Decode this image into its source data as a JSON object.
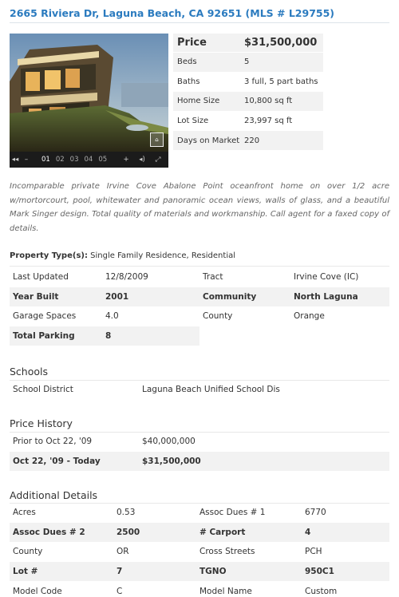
{
  "listing": {
    "title": "2665 Riviera Dr, Laguna Beach, CA 92651 (MLS # L29755)"
  },
  "gallery": {
    "pages": [
      "01",
      "02",
      "03",
      "04",
      "05"
    ],
    "active_page": "01",
    "controls": {
      "prev": "◂◂",
      "minus": "–",
      "plus": "+",
      "sound": "◂)",
      "fullscreen": "⤢"
    },
    "badge_icon": "house-icon"
  },
  "summary": [
    {
      "label": "Price",
      "value": "$31,500,000"
    },
    {
      "label": "Beds",
      "value": "5"
    },
    {
      "label": "Baths",
      "value": "3 full, 5 part baths"
    },
    {
      "label": "Home Size",
      "value": "10,800 sq ft"
    },
    {
      "label": "Lot Size",
      "value": "23,997 sq ft"
    },
    {
      "label": "Days on Market",
      "value": "220"
    }
  ],
  "description": "Incomparable private Irvine Cove Abalone Point oceanfront home on over 1/2 acre w/mortorcourt, pool, whitewater and panoramic ocean views, walls of glass, and a beautiful Mark Singer design. Total quality of materials and workmanship. Call agent for a faxed copy of details.",
  "property_type": {
    "label": "Property Type(s):",
    "value": "Single Family Residence, Residential"
  },
  "details": [
    {
      "k1": "Last Updated",
      "v1": "12/8/2009",
      "k2": "Tract",
      "v2": "Irvine Cove (IC)"
    },
    {
      "k1": "Year Built",
      "v1": "2001",
      "k2": "Community",
      "v2": "North Laguna"
    },
    {
      "k1": "Garage Spaces",
      "v1": "4.0",
      "k2": "County",
      "v2": "Orange"
    },
    {
      "k1": "Total Parking",
      "v1": "8",
      "k2": "",
      "v2": ""
    }
  ],
  "schools": {
    "heading": "Schools",
    "rows": [
      {
        "label": "School District",
        "value": "Laguna Beach Unified School Dis"
      }
    ]
  },
  "price_history": {
    "heading": "Price History",
    "rows": [
      {
        "period": "Prior to Oct 22, '09",
        "price": "$40,000,000"
      },
      {
        "period": "Oct 22, '09 - Today",
        "price": "$31,500,000"
      }
    ]
  },
  "additional": {
    "heading": "Additional Details",
    "rows": [
      {
        "k1": "Acres",
        "v1": "0.53",
        "k2": "Assoc Dues # 1",
        "v2": "6770"
      },
      {
        "k1": "Assoc Dues # 2",
        "v1": "2500",
        "k2": "# Carport",
        "v2": "4"
      },
      {
        "k1": "County",
        "v1": "OR",
        "k2": "Cross Streets",
        "v2": "PCH"
      },
      {
        "k1": "Lot #",
        "v1": "7",
        "k2": "TGNO",
        "v2": "950C1"
      },
      {
        "k1": "Model Code",
        "v1": "C",
        "k2": "Model Name",
        "v2": "Custom"
      }
    ]
  },
  "colors": {
    "title": "#2b7bbf",
    "alt_row": "#f2f2f2",
    "text": "#333333"
  }
}
